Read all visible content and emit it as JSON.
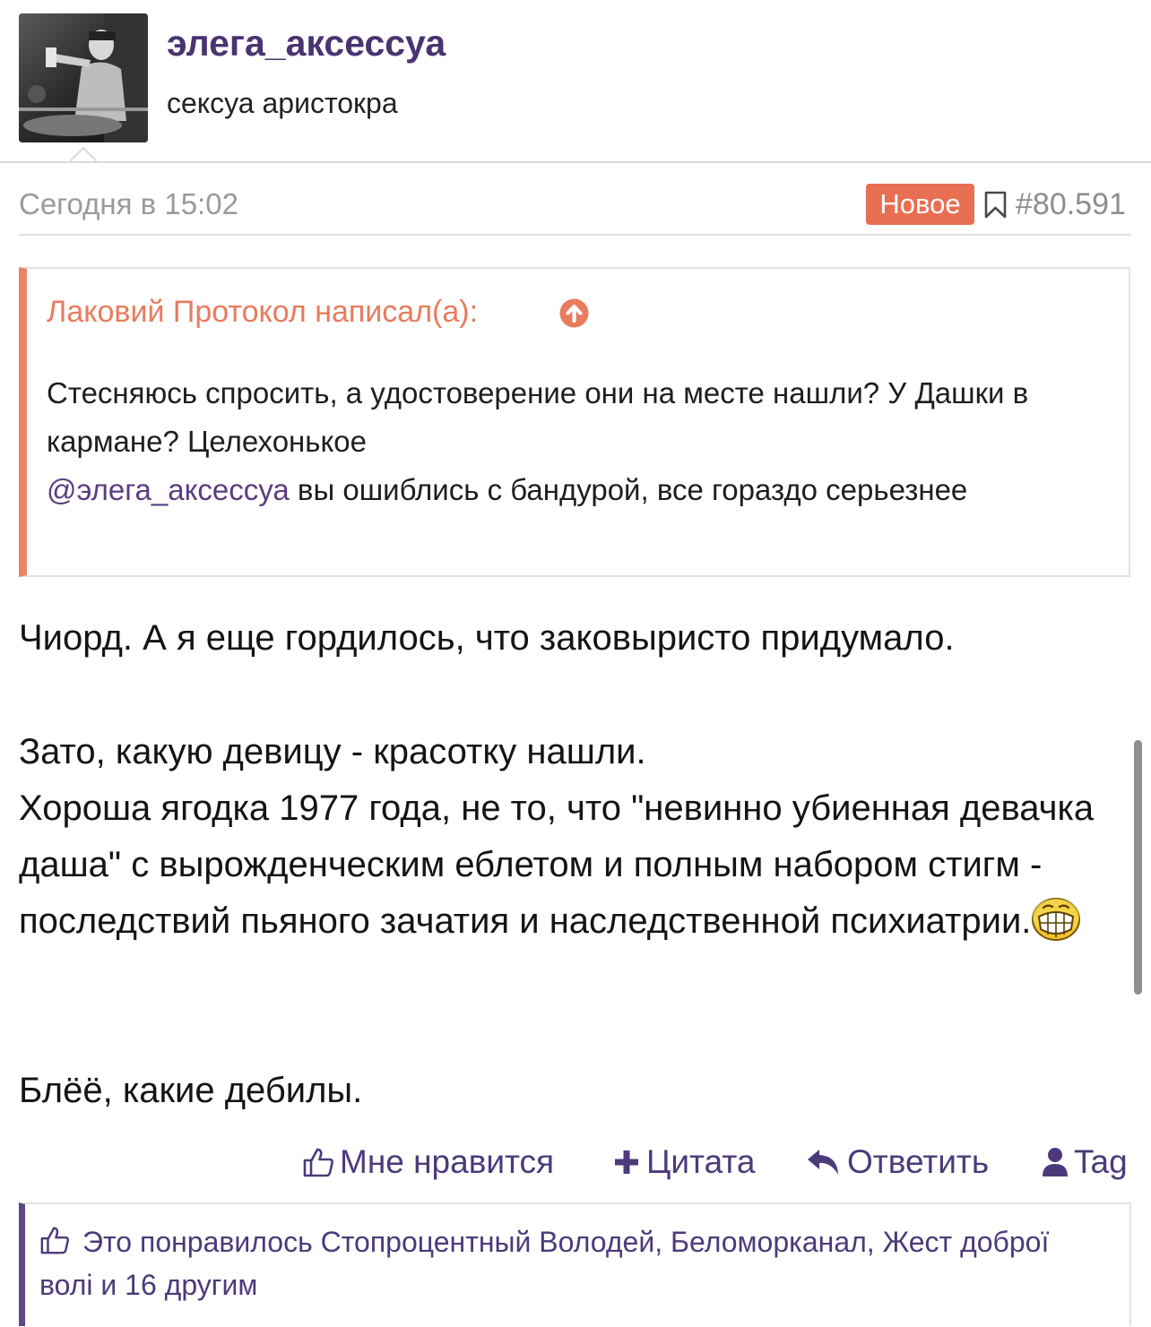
{
  "user": {
    "name": "элега_аксессуа",
    "title": "сексуа аристокра"
  },
  "post": {
    "date": "Сегодня в 15:02",
    "badge": "Новое",
    "number": "#80.591"
  },
  "quote": {
    "author": "Лаковий Протокол написал(а):",
    "line1": "Стесняюсь спросить, а удостоверение они на месте нашли? У Дашки в кармане? Целехонькое",
    "mention": "@элега_аксессуа",
    "line2": " вы ошиблись с бандурой, все гораздо серьезнее"
  },
  "body": {
    "p1": "Чиорд. А я еще гордилось, что заковыристо придумало.",
    "p2": "Зато, какую девицу - красотку нашли.",
    "p3": "Хороша ягодка 1977 года, не то, что \"невинно убиенная девачка даша\" с вырожденческим еблетом и полным набором стигм - последствий пьяного зачатия и наследственной психиатрии.",
    "p4": "Блёё, какие дебилы."
  },
  "actions": {
    "like": "Мне нравится",
    "quote": "Цитата",
    "reply": "Ответить",
    "tag": "Tag"
  },
  "likes": {
    "text": "Это понравилось Стопроцентный Володей, Беломорканал, Жест доброї волі и 16 другим"
  },
  "icons": {
    "quote_up": "arrow-circle-up-icon",
    "bookmark": "bookmark-icon",
    "like": "thumbs-up-icon",
    "quote": "plus-icon",
    "reply": "reply-arrow-icon",
    "tag": "user-icon",
    "emoji": "grinning-emoji-icon"
  },
  "colors": {
    "username": "#4a3471",
    "accent": "#e86f52",
    "link": "#4c3a7b"
  }
}
